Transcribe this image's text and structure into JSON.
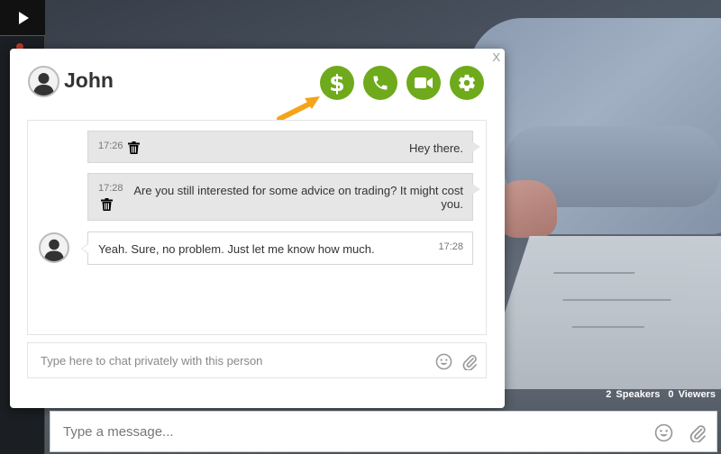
{
  "contact": {
    "name": "John"
  },
  "header": {
    "close_label": "X",
    "actions": [
      {
        "id": "pay",
        "icon": "dollar-icon"
      },
      {
        "id": "call",
        "icon": "phone-icon"
      },
      {
        "id": "video",
        "icon": "video-camera-icon"
      },
      {
        "id": "settings",
        "icon": "gear-icon"
      }
    ]
  },
  "messages": [
    {
      "direction": "sent",
      "time": "17:26",
      "text": "Hey there."
    },
    {
      "direction": "sent",
      "time": "17:28",
      "text": "Are you still interested for some advice on trading? It might cost you."
    },
    {
      "direction": "received",
      "time": "17:28",
      "text": "Yeah. Sure, no problem. Just let me know how much."
    }
  ],
  "private_chat": {
    "placeholder": "Type here to chat privately with this person"
  },
  "room": {
    "speakers_count": "2",
    "speakers_label": "Speakers",
    "viewers_count": "0",
    "viewers_label": "Viewers"
  },
  "main_chat": {
    "placeholder": "Type a message..."
  },
  "colors": {
    "accent": "#6eaa1b",
    "arrow": "#f5a31a",
    "bubble_sent": "#e6e6e6"
  }
}
